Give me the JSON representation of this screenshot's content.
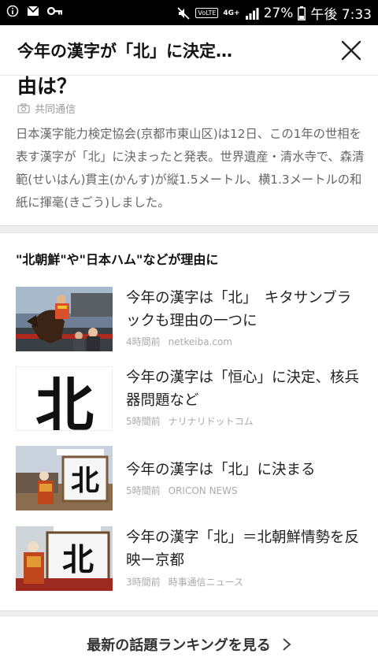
{
  "status_bar": {
    "left_icons": [
      "info-icon",
      "mail-icon",
      "key-icon"
    ],
    "network_label": "VoLTE",
    "signal_label": "4G+",
    "battery": "27%",
    "time": "午後 7:33"
  },
  "header": {
    "title": "今年の漢字が「北」に決定…"
  },
  "article": {
    "title_tail": "由は？",
    "source": "共同通信",
    "body": "日本漢字能力検定協会(京都市東山区)は12日、この1年の世相を表す漢字が「北」に決まったと発表。世界遺産・清水寺で、森清範(せいはん)貫主(かんす)が縦1.5メートル、横1.3メートルの和紙に揮毫(きごう)しました。"
  },
  "related": {
    "heading": "\"北朝鮮\"や\"日本ハム\"などが理由に",
    "items": [
      {
        "title": "今年の漢字は「北」　キタサンブラックも理由の一つに",
        "time": "4時間前",
        "source": "netkeiba.com"
      },
      {
        "title": "今年の漢字は「恒心」に決定、核兵器問題など",
        "time": "5時間前",
        "source": "ナリナリドットコム",
        "thumb_char": "北"
      },
      {
        "title": "今年の漢字は「北」に決まる",
        "time": "5時間前",
        "source": "ORICON NEWS",
        "thumb_char": "北"
      },
      {
        "title": "今年の漢字「北」＝北朝鮮情勢を反映ー京都",
        "time": "3時間前",
        "source": "時事通信ニュース",
        "thumb_char": "北"
      }
    ]
  },
  "footer": {
    "more_label": "最新の話題ランキングを見る"
  }
}
